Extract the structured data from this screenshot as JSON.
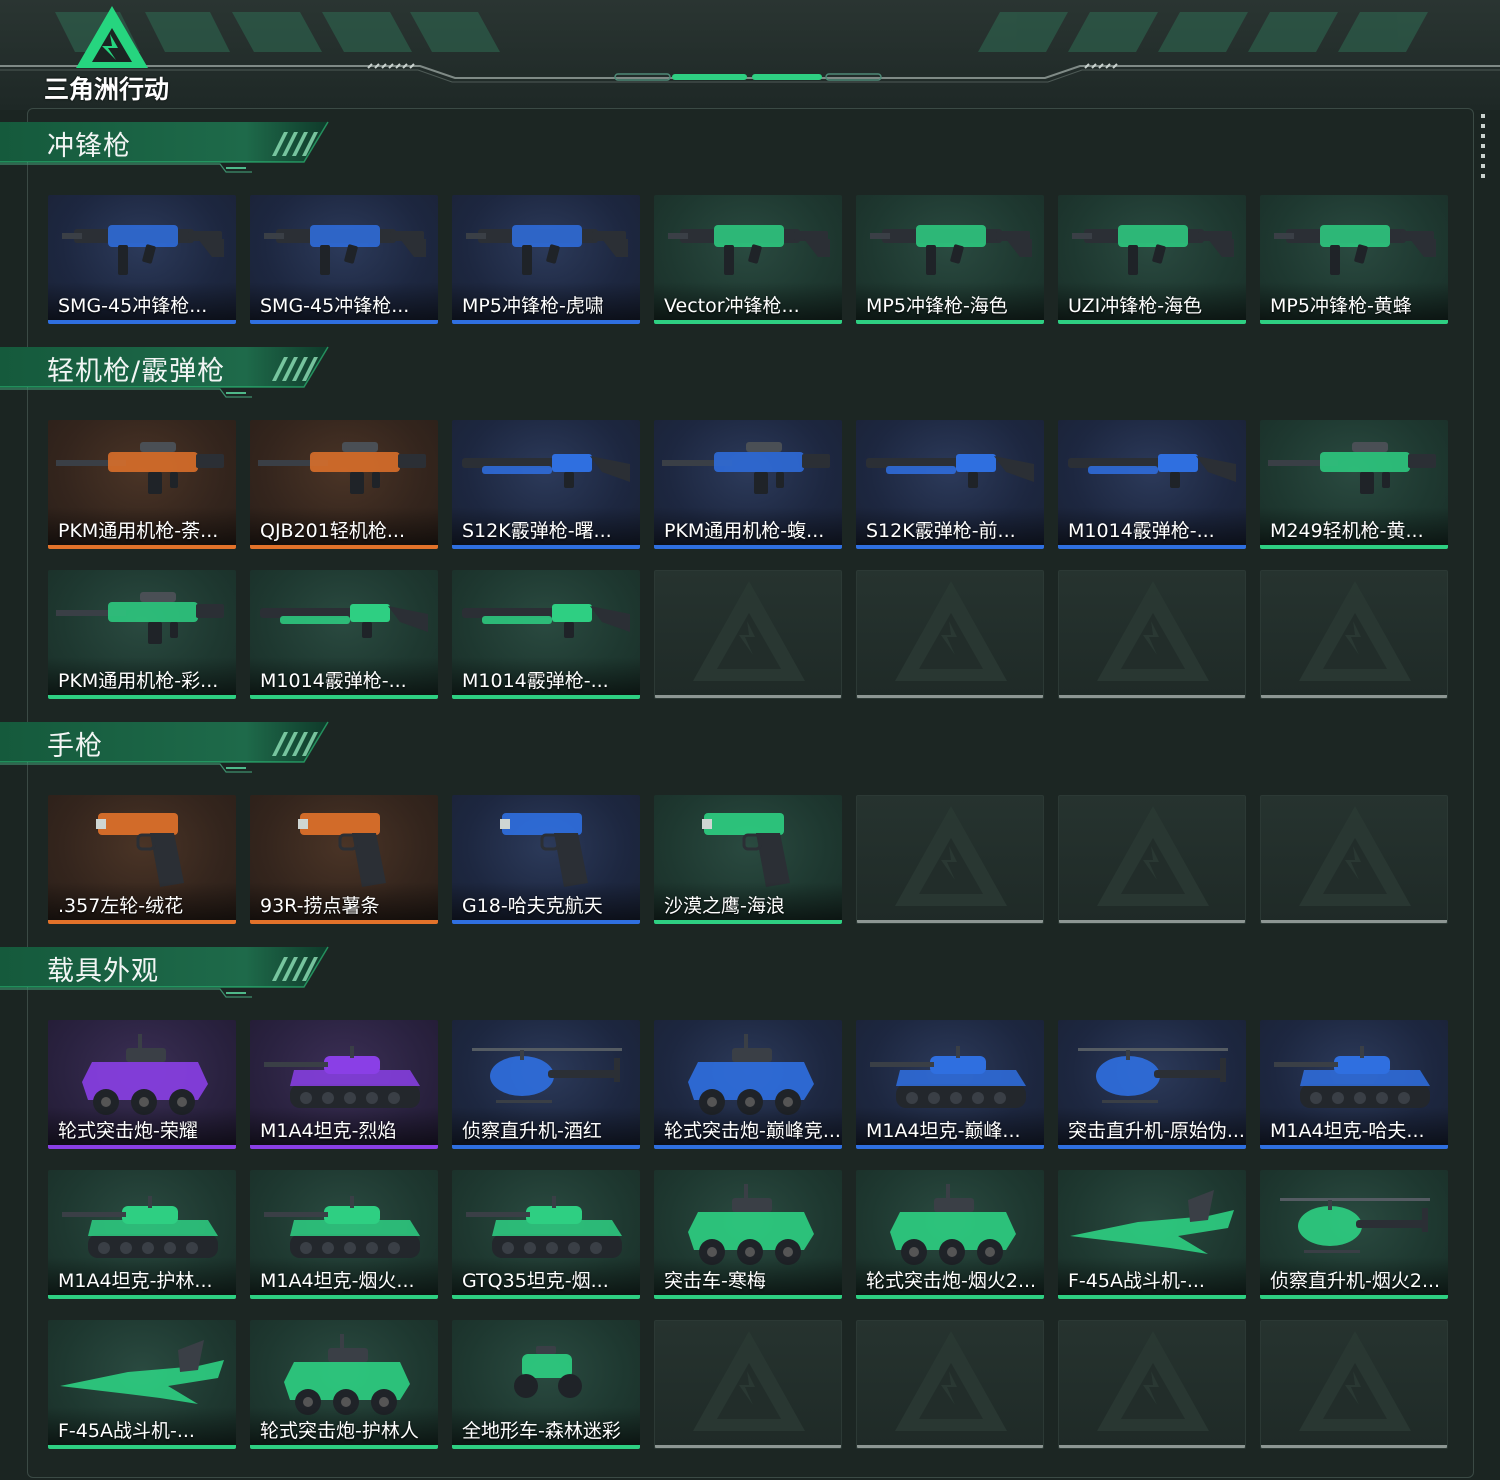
{
  "app": {
    "title": "三角洲行动",
    "logo_icon": "delta-triangle-logo-icon",
    "brand_color": "#2ecf82"
  },
  "rarity_colors": {
    "blue": "#2f6fe0",
    "purple": "#8a3fe6",
    "orange": "#e2722a",
    "green": "#2ecf82"
  },
  "sections": [
    {
      "title": "冲锋枪",
      "items": [
        {
          "label": "SMG-45冲锋枪...",
          "rarity": "blue",
          "icon": "smg-icon"
        },
        {
          "label": "SMG-45冲锋枪...",
          "rarity": "blue",
          "icon": "smg-icon"
        },
        {
          "label": "MP5冲锋枪-虎啸",
          "rarity": "blue",
          "icon": "smg-icon"
        },
        {
          "label": "Vector冲锋枪...",
          "rarity": "green",
          "icon": "smg-icon"
        },
        {
          "label": "MP5冲锋枪-海色",
          "rarity": "green",
          "icon": "smg-icon"
        },
        {
          "label": "UZI冲锋枪-海色",
          "rarity": "green",
          "icon": "smg-icon"
        },
        {
          "label": "MP5冲锋枪-黄蜂",
          "rarity": "green",
          "icon": "smg-icon"
        }
      ]
    },
    {
      "title": "轻机枪/霰弹枪",
      "items": [
        {
          "label": "PKM通用机枪-荼...",
          "rarity": "orange",
          "icon": "machine-gun-icon"
        },
        {
          "label": "QJB201轻机枪...",
          "rarity": "orange",
          "icon": "machine-gun-icon"
        },
        {
          "label": "S12K霰弹枪-曙...",
          "rarity": "blue",
          "icon": "shotgun-icon"
        },
        {
          "label": "PKM通用机枪-蝮...",
          "rarity": "blue",
          "icon": "machine-gun-icon"
        },
        {
          "label": "S12K霰弹枪-前...",
          "rarity": "blue",
          "icon": "shotgun-icon"
        },
        {
          "label": "M1014霰弹枪-...",
          "rarity": "blue",
          "icon": "shotgun-icon"
        },
        {
          "label": "M249轻机枪-黄...",
          "rarity": "green",
          "icon": "machine-gun-icon"
        },
        {
          "label": "PKM通用机枪-彩...",
          "rarity": "green",
          "icon": "machine-gun-icon"
        },
        {
          "label": "M1014霰弹枪-...",
          "rarity": "green",
          "icon": "shotgun-icon"
        },
        {
          "label": "M1014霰弹枪-...",
          "rarity": "green",
          "icon": "shotgun-icon"
        }
      ]
    },
    {
      "title": "手枪",
      "items": [
        {
          "label": ".357左轮-绒花",
          "rarity": "orange",
          "icon": "revolver-icon"
        },
        {
          "label": "93R-捞点薯条",
          "rarity": "orange",
          "icon": "pistol-icon"
        },
        {
          "label": "G18-哈夫克航天",
          "rarity": "blue",
          "icon": "pistol-icon"
        },
        {
          "label": "沙漠之鹰-海浪",
          "rarity": "green",
          "icon": "pistol-icon"
        }
      ]
    },
    {
      "title": "载具外观",
      "items": [
        {
          "label": "轮式突击炮-荣耀",
          "rarity": "purple",
          "icon": "armored-car-icon"
        },
        {
          "label": "M1A4坦克-烈焰",
          "rarity": "purple",
          "icon": "tank-icon"
        },
        {
          "label": "侦察直升机-酒红",
          "rarity": "blue",
          "icon": "helicopter-icon"
        },
        {
          "label": "轮式突击炮-巅峰竞...",
          "rarity": "blue",
          "icon": "armored-car-icon"
        },
        {
          "label": "M1A4坦克-巅峰...",
          "rarity": "blue",
          "icon": "tank-icon"
        },
        {
          "label": "突击直升机-原始伪...",
          "rarity": "blue",
          "icon": "helicopter-icon"
        },
        {
          "label": "M1A4坦克-哈夫...",
          "rarity": "blue",
          "icon": "tank-icon"
        },
        {
          "label": "M1A4坦克-护林...",
          "rarity": "green",
          "icon": "tank-icon"
        },
        {
          "label": "M1A4坦克-烟火...",
          "rarity": "green",
          "icon": "tank-icon"
        },
        {
          "label": "GTQ35坦克-烟...",
          "rarity": "green",
          "icon": "tank-icon"
        },
        {
          "label": "突击车-寒梅",
          "rarity": "green",
          "icon": "armored-car-icon"
        },
        {
          "label": "轮式突击炮-烟火2...",
          "rarity": "green",
          "icon": "armored-car-icon"
        },
        {
          "label": "F-45A战斗机-...",
          "rarity": "green",
          "icon": "fighter-jet-icon"
        },
        {
          "label": "侦察直升机-烟火2...",
          "rarity": "green",
          "icon": "helicopter-icon"
        },
        {
          "label": "F-45A战斗机-...",
          "rarity": "green",
          "icon": "fighter-jet-icon"
        },
        {
          "label": "轮式突击炮-护林人",
          "rarity": "green",
          "icon": "armored-car-icon"
        },
        {
          "label": "全地形车-森林迷彩",
          "rarity": "green",
          "icon": "atv-icon"
        }
      ]
    }
  ]
}
